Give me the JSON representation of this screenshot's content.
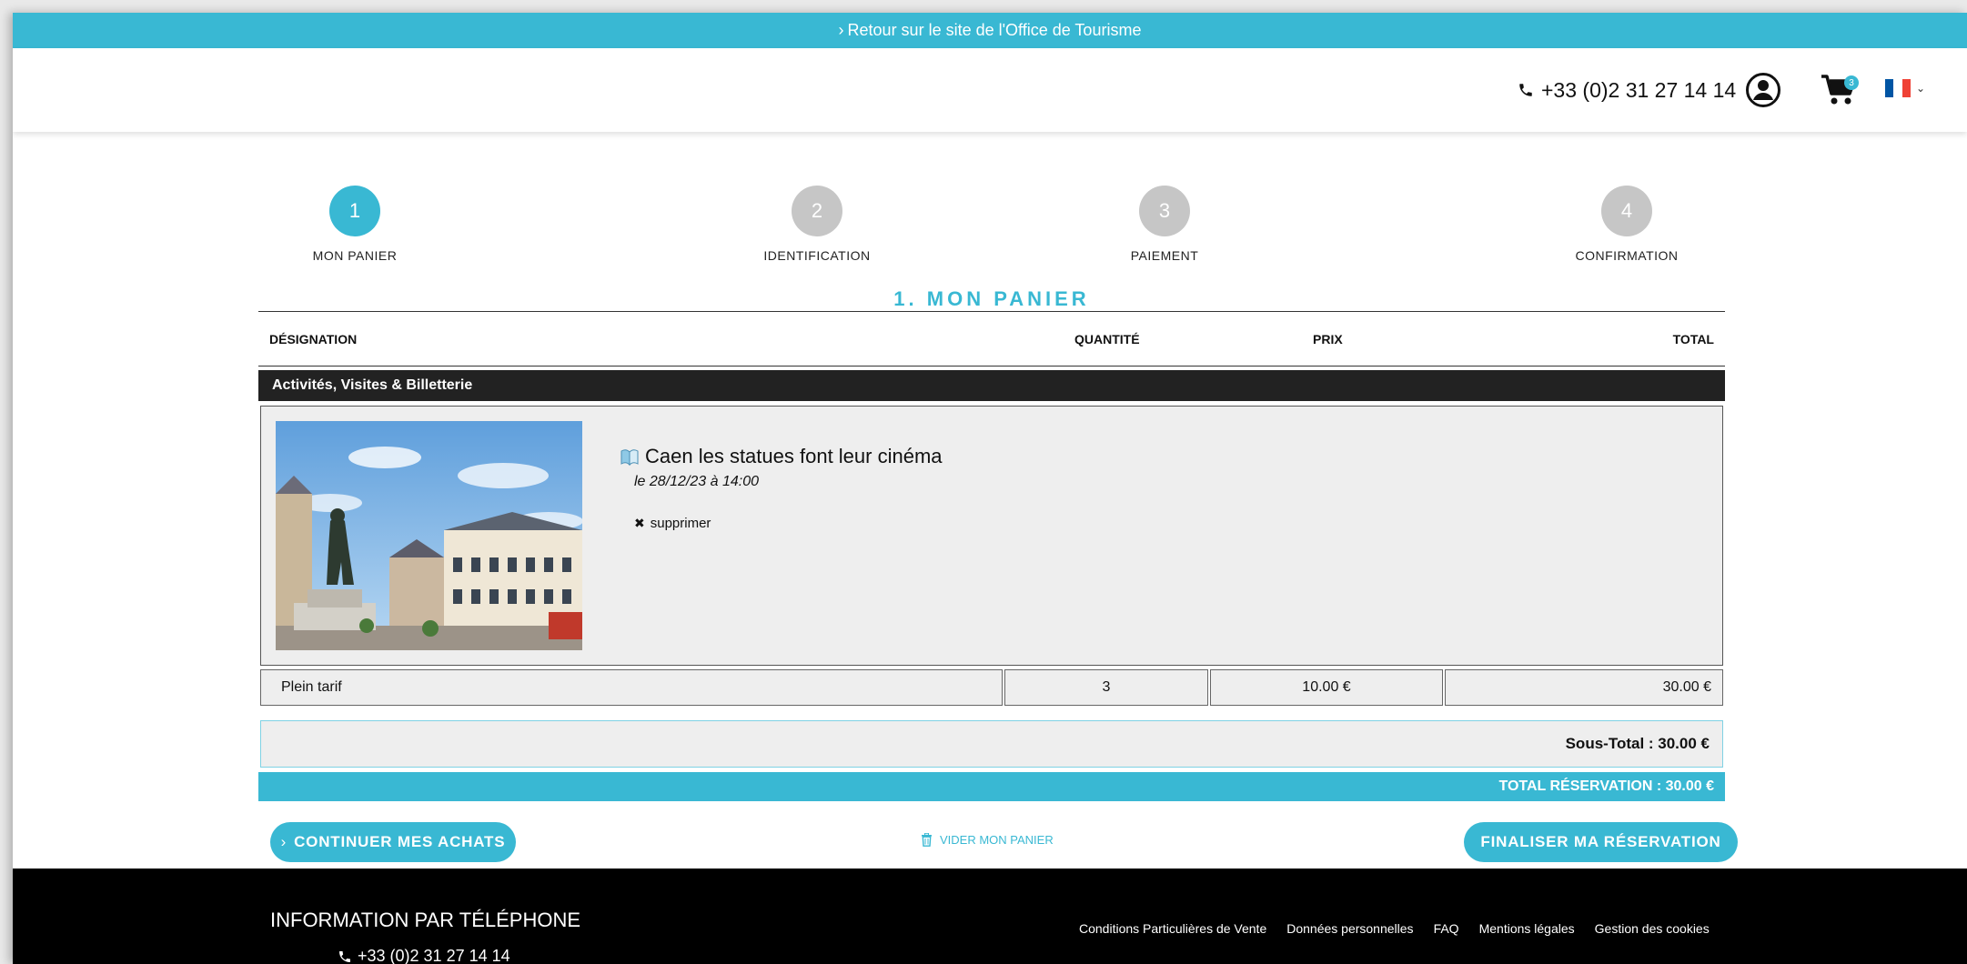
{
  "banner": {
    "text": "Retour sur le site de l'Office de Tourisme"
  },
  "header": {
    "phone": "+33 (0)2 31 27 14 14",
    "cart_count": "3",
    "language": "FR",
    "flag_colors": [
      "#0055A4",
      "#FFFFFF",
      "#EF4135"
    ]
  },
  "steps": [
    {
      "number": "1",
      "label": "MON PANIER",
      "active": true
    },
    {
      "number": "2",
      "label": "IDENTIFICATION",
      "active": false
    },
    {
      "number": "3",
      "label": "PAIEMENT",
      "active": false
    },
    {
      "number": "4",
      "label": "CONFIRMATION",
      "active": false
    }
  ],
  "section_title": "1. MON PANIER",
  "table": {
    "headers": {
      "designation": "DÉSIGNATION",
      "quantity": "QUANTITÉ",
      "price": "PRIX",
      "total": "TOTAL"
    },
    "category": "Activités, Visites & Billetterie",
    "item": {
      "title": "Caen les statues font leur cinéma",
      "date": "le 28/12/23 à 14:00",
      "delete_label": "supprimer",
      "rows": [
        {
          "tarif": "Plein tarif",
          "quantity": "3",
          "price": "10.00 €",
          "total": "30.00 €"
        }
      ]
    },
    "subtotal": "Sous-Total : 30.00 €",
    "total_reservation": "TOTAL RÉSERVATION : 30.00 €"
  },
  "actions": {
    "continue": "CONTINUER MES ACHATS",
    "empty_cart": "VIDER MON PANIER",
    "finalize": "FINALISER MA RÉSERVATION"
  },
  "footer": {
    "title": "INFORMATION PAR TÉLÉPHONE",
    "phone": "+33 (0)2 31 27 14 14",
    "links": [
      "Conditions Particulières de Vente",
      "Données personnelles",
      "FAQ",
      "Mentions légales",
      "Gestion des cookies"
    ]
  },
  "colors": {
    "accent": "#39b8d3",
    "dark": "#222222",
    "inactive_step": "#c6c6c6"
  }
}
